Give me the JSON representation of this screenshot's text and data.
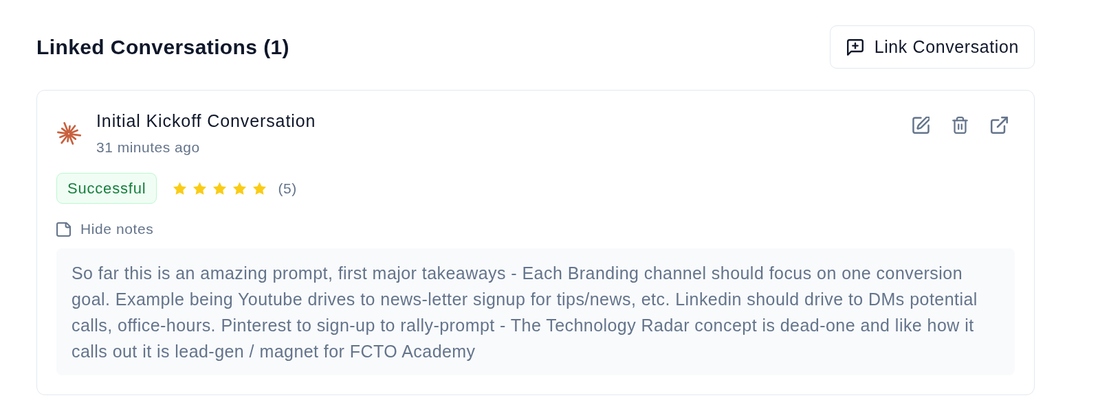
{
  "header": {
    "title": "Linked Conversations (1)",
    "link_button": "Link Conversation"
  },
  "conversations": [
    {
      "title": "Initial Kickoff Conversation",
      "time": "31 minutes ago",
      "status": {
        "label": "Successful",
        "kind": "success"
      },
      "stars": 5,
      "rating_count": "(5)",
      "notes": {
        "toggle_label": "Hide notes",
        "expanded": true,
        "text": "So far this is an amazing prompt, first major takeaways - Each Branding channel should focus on one conversion goal. Example being Youtube drives to news-letter signup for tips/news, etc. Linkedin should drive to DMs potential calls, office-hours. Pinterest to sign-up to rally-prompt - The Technology Radar concept is dead-one and like how it calls out it is lead-gen / magnet for FCTO Academy"
      }
    }
  ]
}
